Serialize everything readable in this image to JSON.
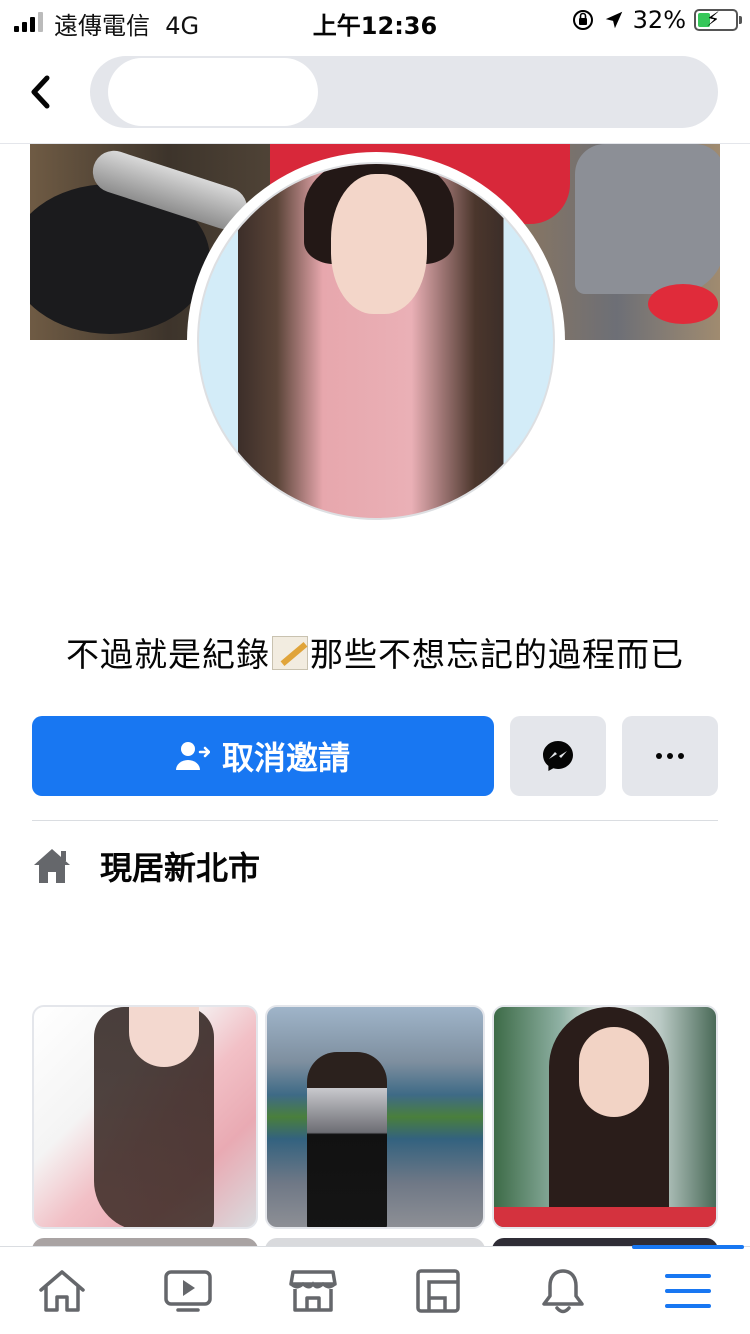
{
  "status_bar": {
    "carrier": "遠傳電信",
    "network": "4G",
    "time": "上午12:36",
    "battery_percent": "32%",
    "battery_level": 0.32
  },
  "header": {
    "search_value": ""
  },
  "profile": {
    "bio": {
      "before": "不過就是紀錄",
      "emoji": "memo-icon",
      "after": "那些不想忘記的過程而已"
    },
    "primary_action": "取消邀請",
    "location": "現居新北市"
  },
  "tabs": [
    {
      "name": "home",
      "icon": "home-icon"
    },
    {
      "name": "watch",
      "icon": "video-icon"
    },
    {
      "name": "marketplace",
      "icon": "store-icon"
    },
    {
      "name": "feeds",
      "icon": "feeds-icon"
    },
    {
      "name": "notifications",
      "icon": "bell-icon"
    },
    {
      "name": "menu",
      "icon": "menu-icon",
      "active": true
    }
  ],
  "colors": {
    "accent": "#1877f2",
    "secondary_button": "#e4e6eb",
    "icon_gray": "#65676b"
  }
}
